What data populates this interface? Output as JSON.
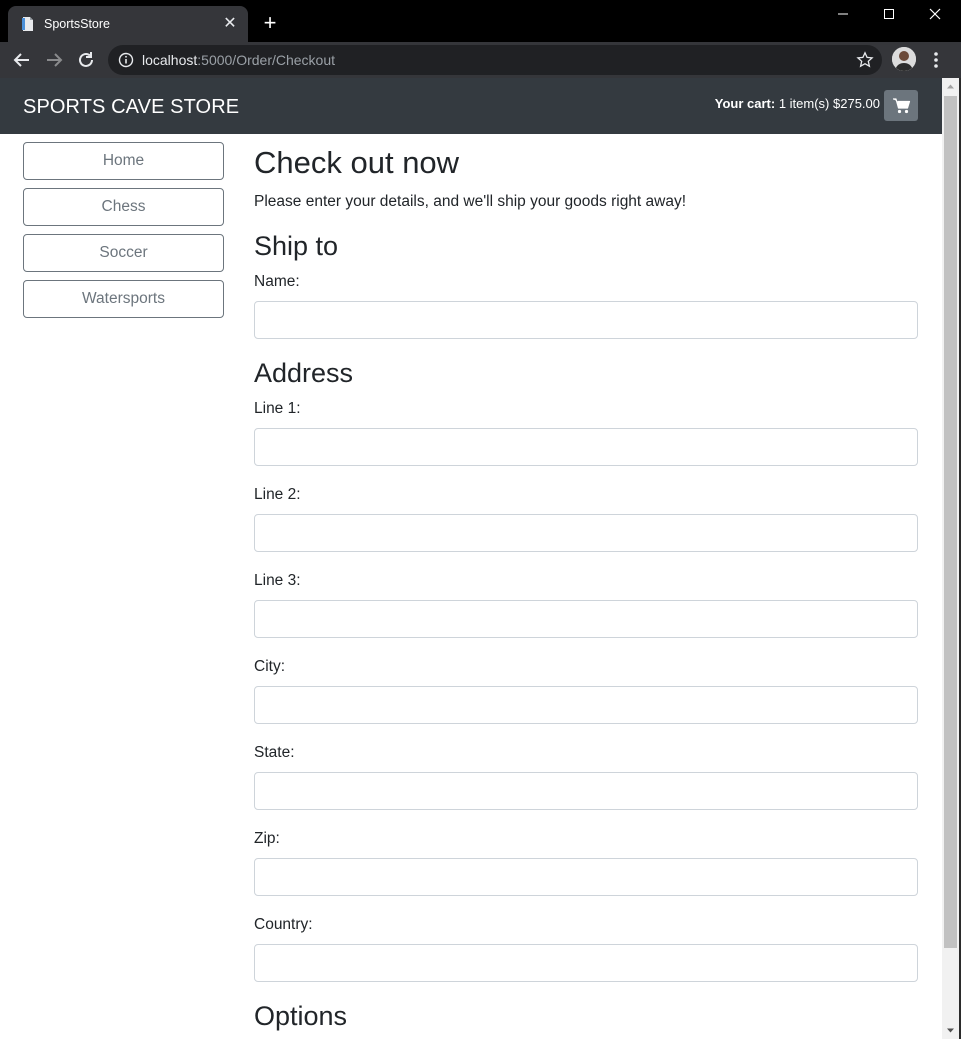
{
  "browser": {
    "tab_title": "SportsStore",
    "url_host": "localhost",
    "url_path": ":5000/Order/Checkout"
  },
  "store": {
    "brand": "SPORTS CAVE STORE",
    "cart_label": "Your cart:",
    "cart_summary": " 1 item(s) $275.00"
  },
  "categories": [
    "Home",
    "Chess",
    "Soccer",
    "Watersports"
  ],
  "checkout": {
    "title": "Check out now",
    "lead": "Please enter your details, and we'll ship your goods right away!",
    "ship_to_heading": "Ship to",
    "name_label": "Name:",
    "address_heading": "Address",
    "line1_label": "Line 1:",
    "line2_label": "Line 2:",
    "line3_label": "Line 3:",
    "city_label": "City:",
    "state_label": "State:",
    "zip_label": "Zip:",
    "country_label": "Country:",
    "options_heading": "Options"
  }
}
